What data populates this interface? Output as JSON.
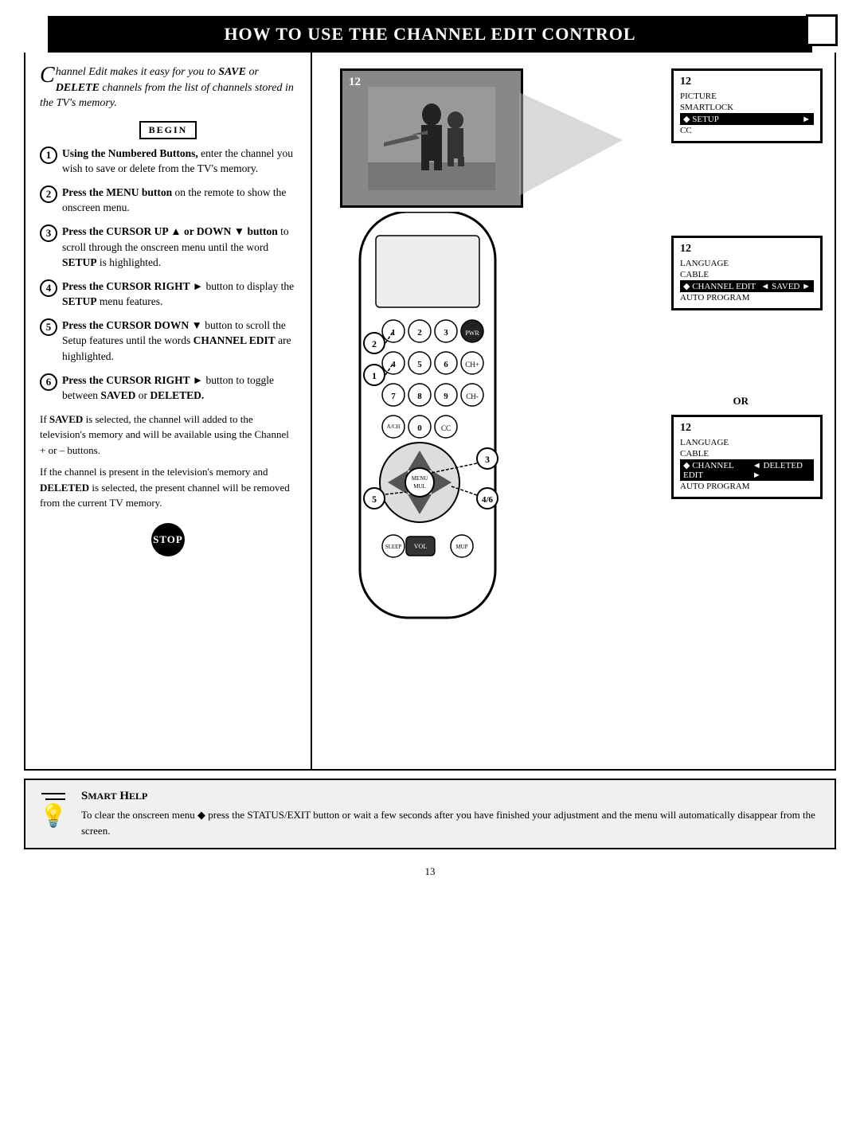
{
  "page": {
    "title": "How to Use the Channel Edit Control",
    "page_number": "13"
  },
  "header": {
    "title": "HOW TO USE THE CHANNEL EDIT CONTROL"
  },
  "intro": {
    "drop_cap": "C",
    "text": "hannel Edit makes it easy for you to SAVE or DELETE channels from the list of channels stored in the TV's memory."
  },
  "begin_label": "BEGIN",
  "steps": [
    {
      "number": "1",
      "bold": "Using the Numbered Buttons,",
      "text": " enter the channel you wish to save or delete from the TV's memory."
    },
    {
      "number": "2",
      "bold": "Press the MENU button",
      "text": " on the remote to show the onscreen menu."
    },
    {
      "number": "3",
      "bold": "Press the CURSOR UP ▲ or DOWN ▼ button",
      "text": " to scroll through the onscreen menu until the word SETUP is highlighted."
    },
    {
      "number": "4",
      "bold": "Press the CURSOR RIGHT ►",
      "text": " button to display the SETUP menu features."
    },
    {
      "number": "5",
      "bold": "Press the CURSOR DOWN ▼",
      "text": " button to scroll the Setup features until the words CHANNEL EDIT are highlighted."
    },
    {
      "number": "6",
      "bold": "Press the CURSOR RIGHT ►",
      "text": " button to toggle between SAVED or DELETED."
    }
  ],
  "saved_text": "If SAVED is selected, the channel will added to the television's memory and will be available using the Channel + or – buttons.",
  "deleted_text": "If the channel is present in the television's memory and DELETED is selected, the present channel will be removed from the current TV memory.",
  "stop_label": "STOP",
  "menu_screen1": {
    "channel": "12",
    "items": [
      "PICTURE",
      "SMARTLOCK",
      "SETUP",
      "CC"
    ],
    "highlighted": "SETUP"
  },
  "menu_screen2": {
    "channel": "12",
    "items": [
      "LANGUAGE",
      "CABLE",
      "CHANNEL EDIT",
      "AUTO PROGRAM"
    ],
    "highlighted": "CHANNEL EDIT",
    "value": "SAVED"
  },
  "menu_screen3": {
    "channel": "12",
    "items": [
      "LANGUAGE",
      "CABLE",
      "CHANNEL EDIT",
      "AUTO PROGRAM"
    ],
    "highlighted": "CHANNEL EDIT",
    "value": "DELETED"
  },
  "or_label": "OR",
  "smart_help": {
    "title": "Smart Help",
    "text": "To clear the onscreen menu press the STATUS/EXIT button or wait a few seconds after you have finished your adjustment and the menu will automatically disappear from the screen."
  }
}
